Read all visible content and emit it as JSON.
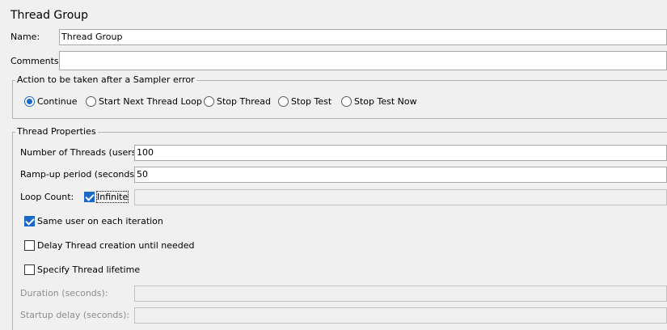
{
  "panel": {
    "title": "Thread Group",
    "name_label": "Name:",
    "name_value": "Thread Group",
    "comments_label": "Comments:",
    "comments_value": ""
  },
  "sampler_error": {
    "legend": "Action to be taken after a Sampler error",
    "options": [
      {
        "label": "Continue",
        "selected": true
      },
      {
        "label": "Start Next Thread Loop",
        "selected": false
      },
      {
        "label": "Stop Thread",
        "selected": false
      },
      {
        "label": "Stop Test",
        "selected": false
      },
      {
        "label": "Stop Test Now",
        "selected": false
      }
    ]
  },
  "thread_props": {
    "legend": "Thread Properties",
    "threads_label": "Number of Threads (users):",
    "threads_value": "100",
    "rampup_label": "Ramp-up period (seconds):",
    "rampup_value": "50",
    "loop_label": "Loop Count:",
    "infinite_label": "Infinite",
    "infinite_checked": true,
    "loop_value": "",
    "same_user_label": "Same user on each iteration",
    "same_user_checked": true,
    "delay_label": "Delay Thread creation until needed",
    "delay_checked": false,
    "lifetime_label": "Specify Thread lifetime",
    "lifetime_checked": false,
    "duration_label": "Duration (seconds):",
    "duration_value": "",
    "startup_label": "Startup delay (seconds):",
    "startup_value": ""
  },
  "colors": {
    "accent": "#1c68c7",
    "background": "#f0f0f0",
    "disabled_text": "#8c8c8c"
  }
}
